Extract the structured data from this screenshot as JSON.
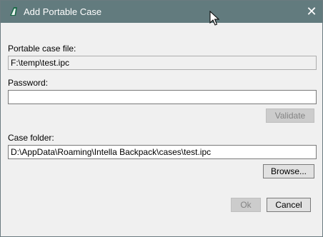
{
  "window": {
    "title": "Add Portable Case"
  },
  "portable_case": {
    "label": "Portable case file:",
    "value": "F:\\temp\\test.ipc"
  },
  "password": {
    "label": "Password:",
    "value": ""
  },
  "validate_label": "Validate",
  "case_folder": {
    "label": "Case folder:",
    "value": "D:\\AppData\\Roaming\\Intella Backpack\\cases\\test.ipc"
  },
  "browse_label": "Browse...",
  "footer": {
    "ok_label": "Ok",
    "cancel_label": "Cancel"
  },
  "colors": {
    "titlebar": "#627b7e",
    "window_bg": "#f0f0f0"
  },
  "icons": {
    "app": "intella-app-icon",
    "close": "close-icon"
  }
}
